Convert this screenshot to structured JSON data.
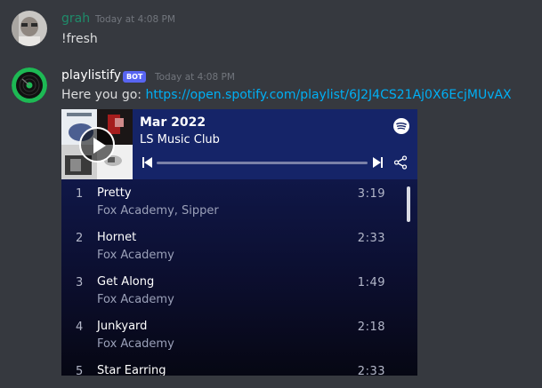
{
  "messages": [
    {
      "username": "grah",
      "username_color": "#1f8b6a",
      "timestamp": "Today at 4:08 PM",
      "text": "!fresh"
    },
    {
      "username": "playlistify",
      "username_color": "#ffffff",
      "bot_tag": "BOT",
      "timestamp": "Today at 4:08 PM",
      "text_prefix": "Here you go: ",
      "link": "https://open.spotify.com/playlist/6J2J4CS21Aj0X6EcjMUvAX"
    }
  ],
  "embed": {
    "title": "Mar 2022",
    "owner": "LS Music Club",
    "tracks": [
      {
        "num": "1",
        "title": "Pretty",
        "artist": "Fox Academy, Sipper",
        "duration": "3:19"
      },
      {
        "num": "2",
        "title": "Hornet",
        "artist": "Fox Academy",
        "duration": "2:33"
      },
      {
        "num": "3",
        "title": "Get Along",
        "artist": "Fox Academy",
        "duration": "1:49"
      },
      {
        "num": "4",
        "title": "Junkyard",
        "artist": "Fox Academy",
        "duration": "2:18"
      },
      {
        "num": "5",
        "title": "Star Earring",
        "artist": "",
        "duration": "2:33"
      }
    ]
  },
  "colors": {
    "background": "#36393f",
    "link": "#00aff4",
    "bot_tag": "#5865f2",
    "spotify_green": "#1db954"
  },
  "icons": {
    "spotify": "spotify-icon",
    "play": "play-icon",
    "prev": "skip-back-icon",
    "next": "skip-forward-icon",
    "share": "share-icon"
  }
}
